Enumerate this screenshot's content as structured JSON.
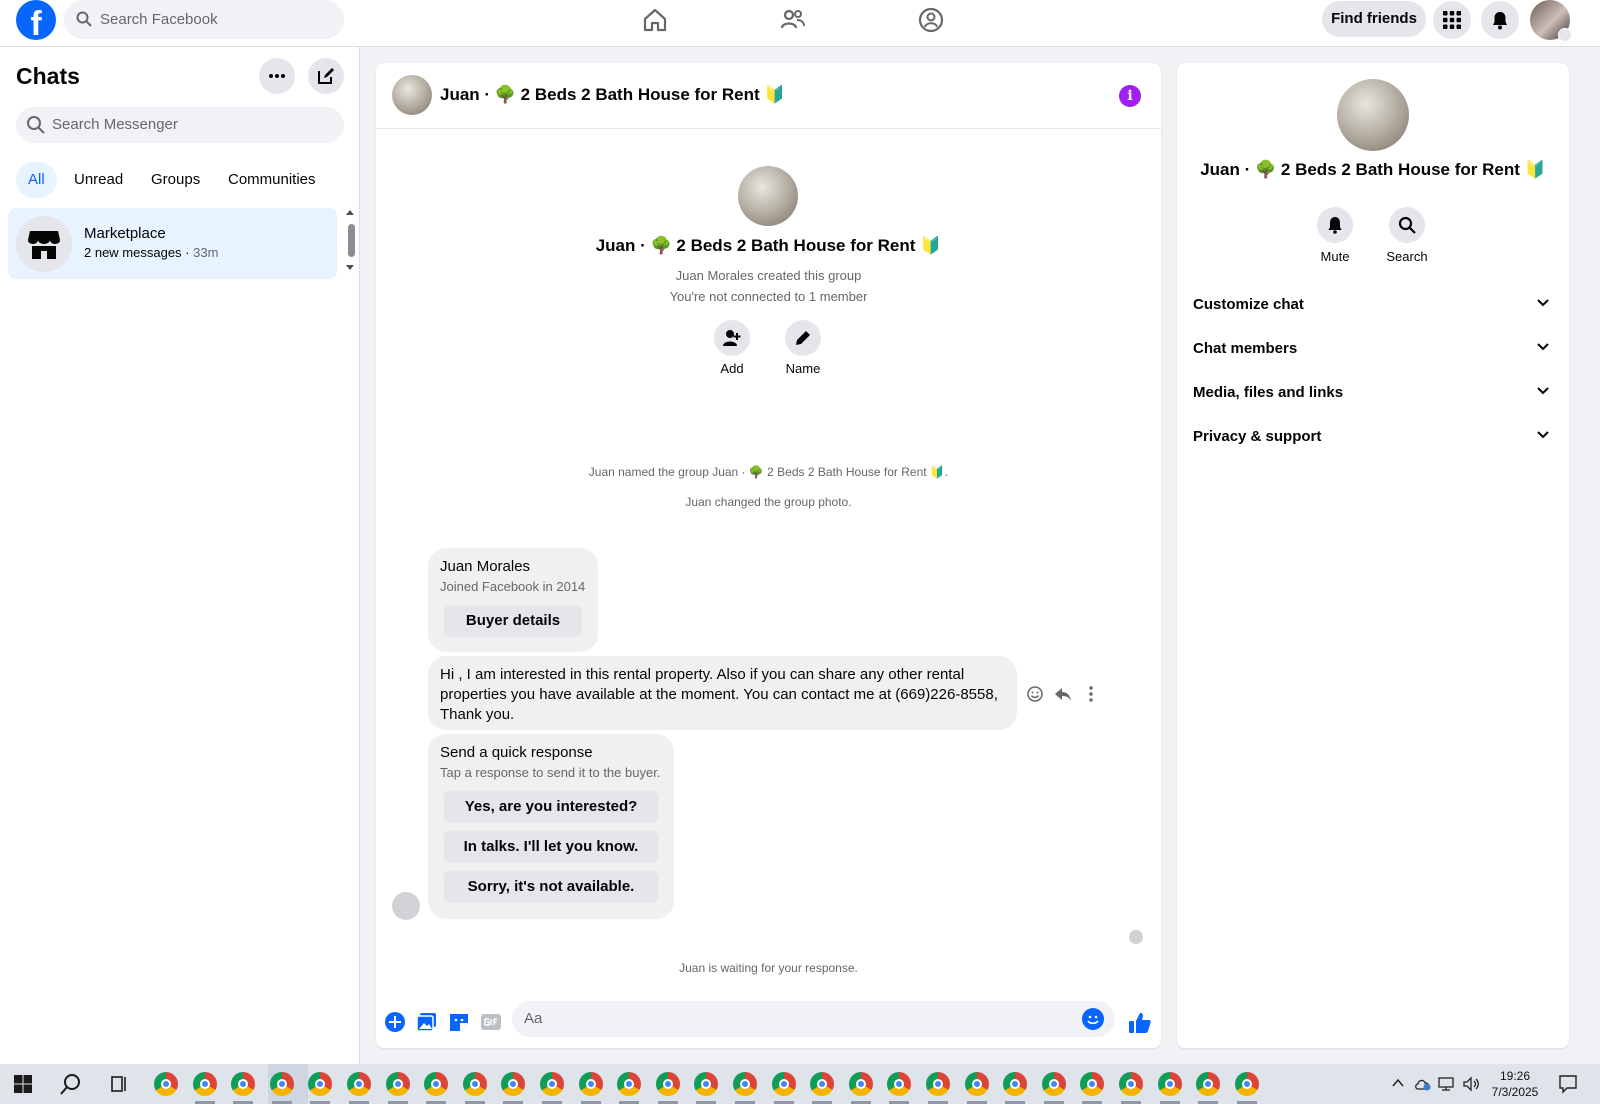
{
  "topbar": {
    "search_placeholder": "Search Facebook",
    "find_friends": "Find friends"
  },
  "sidebar": {
    "title": "Chats",
    "search_placeholder": "Search Messenger",
    "filters": [
      "All",
      "Unread",
      "Groups",
      "Communities"
    ],
    "active_filter": "All",
    "chats": [
      {
        "name": "Marketplace",
        "preview": "2 new messages",
        "time": "33m"
      }
    ]
  },
  "chat": {
    "title": "Juan · 🌳 2 Beds 2 Bath House for Rent 🔰",
    "creator_line": "Juan Morales created this group",
    "connect_line": "You're not connected to 1 member",
    "actions": [
      "Add",
      "Name"
    ],
    "system_messages": [
      "Juan named the group Juan · 🌳 2 Beds 2 Bath House for Rent 🔰.",
      "Juan changed the group photo."
    ],
    "buyer_card": {
      "name": "Juan Morales",
      "joined": "Joined Facebook in 2014",
      "button": "Buyer details"
    },
    "message": "Hi , I am interested in this rental property. Also if you can share any other rental properties you have available at the moment. You can contact me at (669)226-8558, Thank you.",
    "quick_response": {
      "title": "Send a quick response",
      "subtitle": "Tap a response to send it to the buyer.",
      "options": [
        "Yes, are you interested?",
        "In talks. I'll let you know.",
        "Sorry, it's not available."
      ]
    },
    "waiting": "Juan is waiting for your response.",
    "composer_placeholder": "Aa"
  },
  "info_panel": {
    "title": "Juan · 🌳 2 Beds 2 Bath House for Rent 🔰",
    "actions": [
      "Mute",
      "Search"
    ],
    "sections": [
      "Customize chat",
      "Chat members",
      "Media, files and links",
      "Privacy & support"
    ]
  },
  "taskbar": {
    "time": "19:26",
    "date": "7/3/2025"
  },
  "colors": {
    "brand": "#0866ff",
    "info_accent": "#a020f0",
    "selected_bg": "#e7f3ff"
  }
}
